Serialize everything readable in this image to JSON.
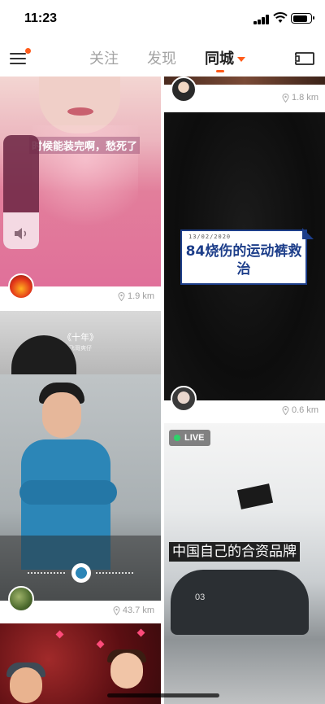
{
  "status_bar": {
    "time": "11:23",
    "battery_level": 0.85
  },
  "nav": {
    "tabs": [
      {
        "label": "关注",
        "active": false
      },
      {
        "label": "发现",
        "active": false
      },
      {
        "label": "同城",
        "active": true
      }
    ],
    "accent_color": "#ff5b1a",
    "icons": {
      "menu": "menu-icon",
      "cast": "cast-screen-icon"
    }
  },
  "volume_hud": {
    "level": 0.32,
    "icon": "speaker-icon"
  },
  "feed": {
    "left": [
      {
        "id": "card-1",
        "subtitle": "时候能装完啊，愁死了",
        "distance": "1.9 km"
      },
      {
        "id": "card-4",
        "song_title": "《十年》",
        "song_artist": "飞哥爽仔",
        "distance": "43.7 km"
      },
      {
        "id": "card-6"
      }
    ],
    "right": [
      {
        "id": "card-2",
        "distance": "1.8 km"
      },
      {
        "id": "card-3",
        "poster_date": "13/02/2020",
        "poster_headline": "84烧伤的运动裤救治",
        "distance": "0.6 km"
      },
      {
        "id": "card-5",
        "live_label": "LIVE",
        "caption": "中国自己的合资品牌",
        "car_label": "03"
      }
    ]
  }
}
